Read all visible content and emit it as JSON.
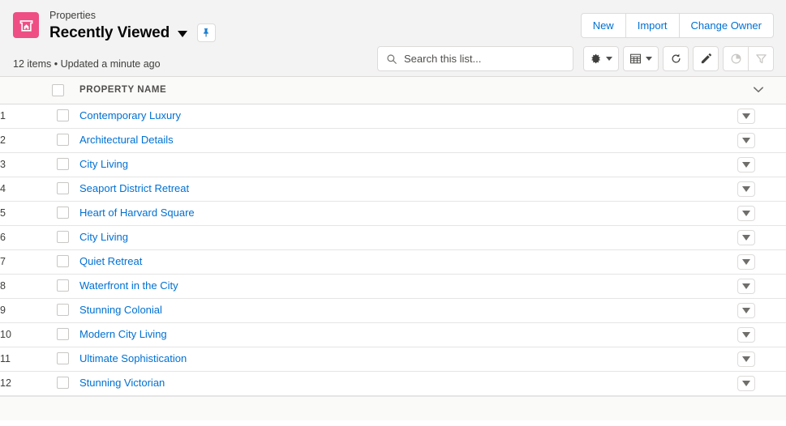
{
  "header": {
    "app_icon": "property-house-icon",
    "accent_color": "#ee4e84",
    "object_type": "Properties",
    "list_view_name": "Recently Viewed",
    "list_view_caret": "chevron-down-icon",
    "pin_icon": "pin-icon",
    "meta_text": "12 items • Updated a minute ago"
  },
  "actions": [
    {
      "label": "New",
      "name": "new-button"
    },
    {
      "label": "Import",
      "name": "import-button"
    },
    {
      "label": "Change Owner",
      "name": "change-owner-button"
    }
  ],
  "search": {
    "placeholder": "Search this list...",
    "value": "",
    "icon": "search-icon"
  },
  "toolbar": [
    {
      "name": "list-view-controls-button",
      "icon": "gear-icon",
      "has_caret": true,
      "disabled": false
    },
    {
      "name": "display-as-button",
      "icon": "table-grid-icon",
      "has_caret": true,
      "disabled": false
    },
    {
      "name": "refresh-button",
      "icon": "refresh-icon",
      "has_caret": false,
      "disabled": false
    },
    {
      "name": "edit-button",
      "icon": "pencil-icon",
      "has_caret": false,
      "disabled": false
    },
    {
      "name": "charts-button",
      "icon": "chart-pie-icon",
      "has_caret": false,
      "disabled": true
    },
    {
      "name": "filter-button",
      "icon": "funnel-filter-icon",
      "has_caret": false,
      "disabled": true
    }
  ],
  "table": {
    "select_all_checkbox": "select-all-checkbox",
    "column_header": "Property Name",
    "column_actions_icon": "chevron-down-icon",
    "link_color": "#0070d2",
    "rows": [
      {
        "num": "1",
        "name": "Contemporary Luxury"
      },
      {
        "num": "2",
        "name": "Architectural Details"
      },
      {
        "num": "3",
        "name": "City Living"
      },
      {
        "num": "4",
        "name": "Seaport District Retreat"
      },
      {
        "num": "5",
        "name": "Heart of Harvard Square"
      },
      {
        "num": "6",
        "name": "City Living"
      },
      {
        "num": "7",
        "name": "Quiet Retreat"
      },
      {
        "num": "8",
        "name": "Waterfront in the City"
      },
      {
        "num": "9",
        "name": "Stunning Colonial"
      },
      {
        "num": "10",
        "name": "Modern City Living"
      },
      {
        "num": "11",
        "name": "Ultimate Sophistication"
      },
      {
        "num": "12",
        "name": "Stunning Victorian"
      }
    ]
  }
}
